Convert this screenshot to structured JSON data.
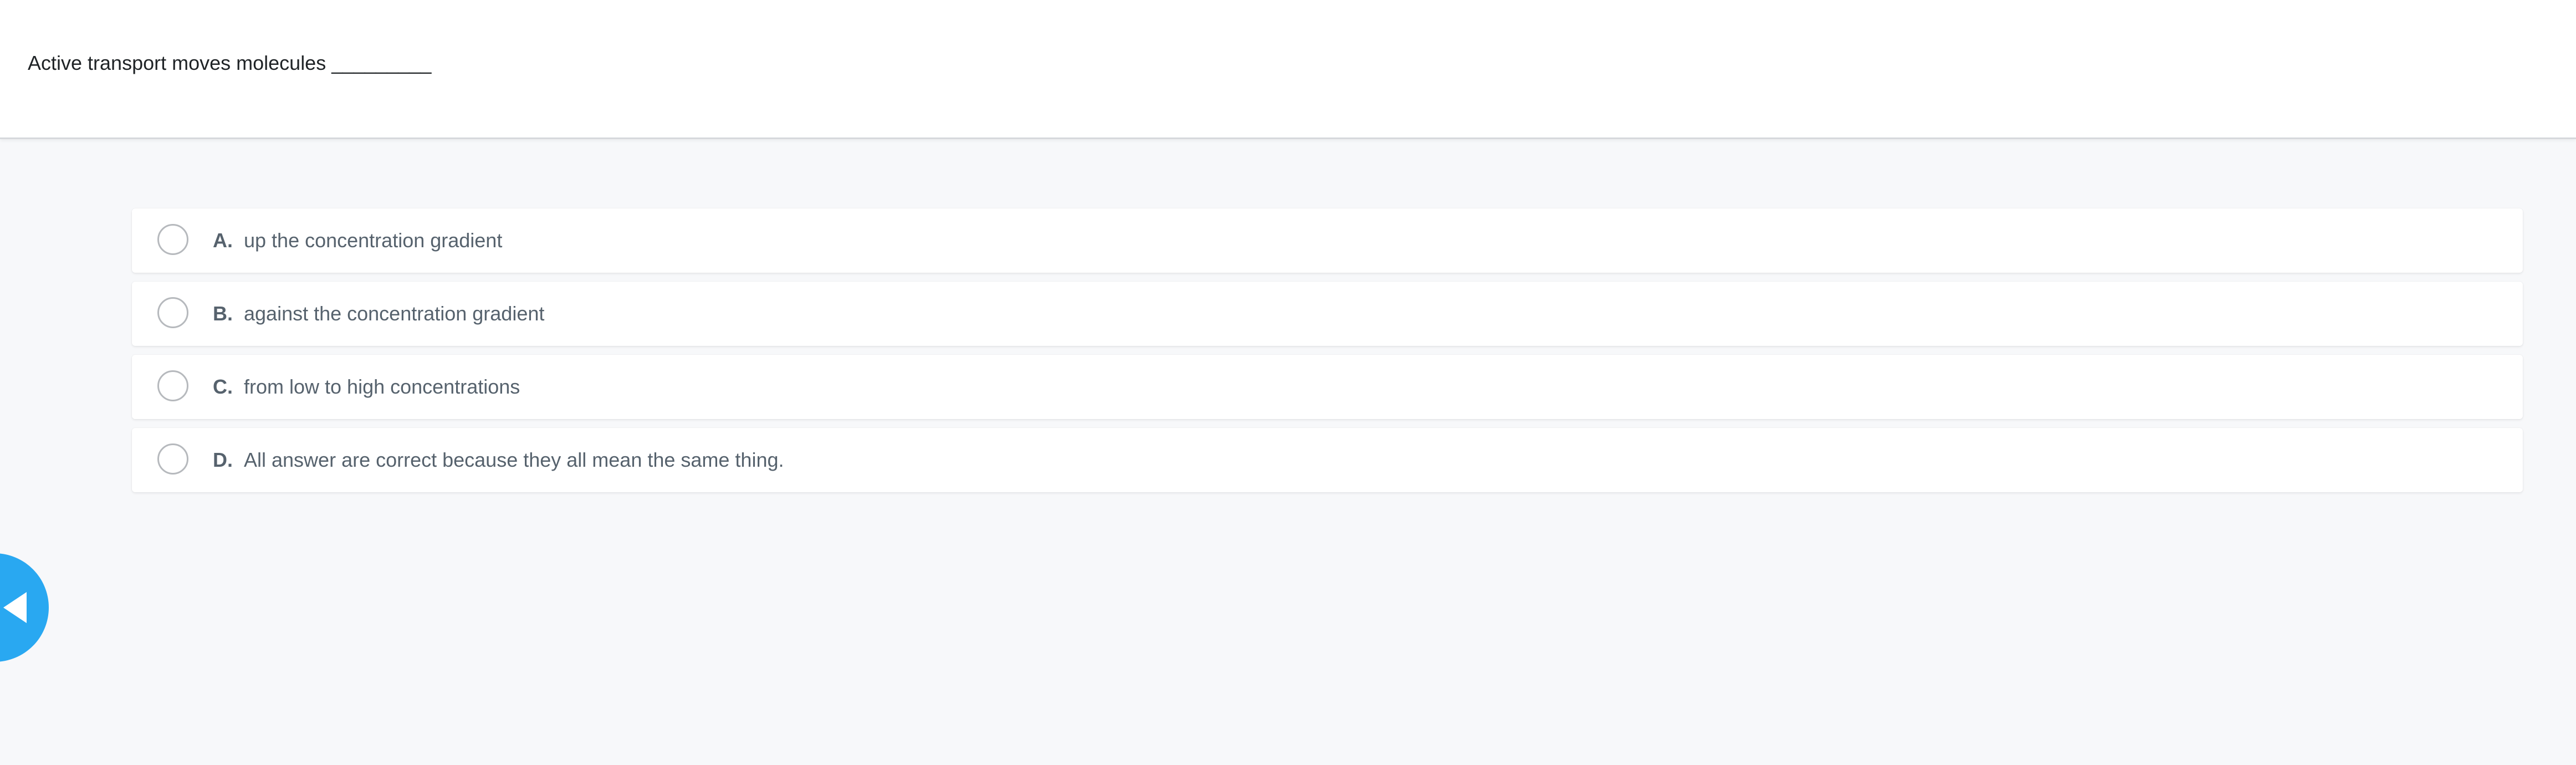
{
  "question": {
    "text": "Active transport moves molecules _________"
  },
  "options": [
    {
      "letter": "A.",
      "text": "up the concentration gradient"
    },
    {
      "letter": "B.",
      "text": "against the concentration gradient"
    },
    {
      "letter": "C.",
      "text": "from low to high concentrations"
    },
    {
      "letter": "D.",
      "text": "All answer are correct because they all mean the same thing."
    }
  ],
  "nav": {
    "back_icon": "triangle-left-icon"
  },
  "colors": {
    "accent": "#29a8f1",
    "background": "#f7f8fa",
    "option_text": "#56626d",
    "question_text": "#1f2326"
  }
}
